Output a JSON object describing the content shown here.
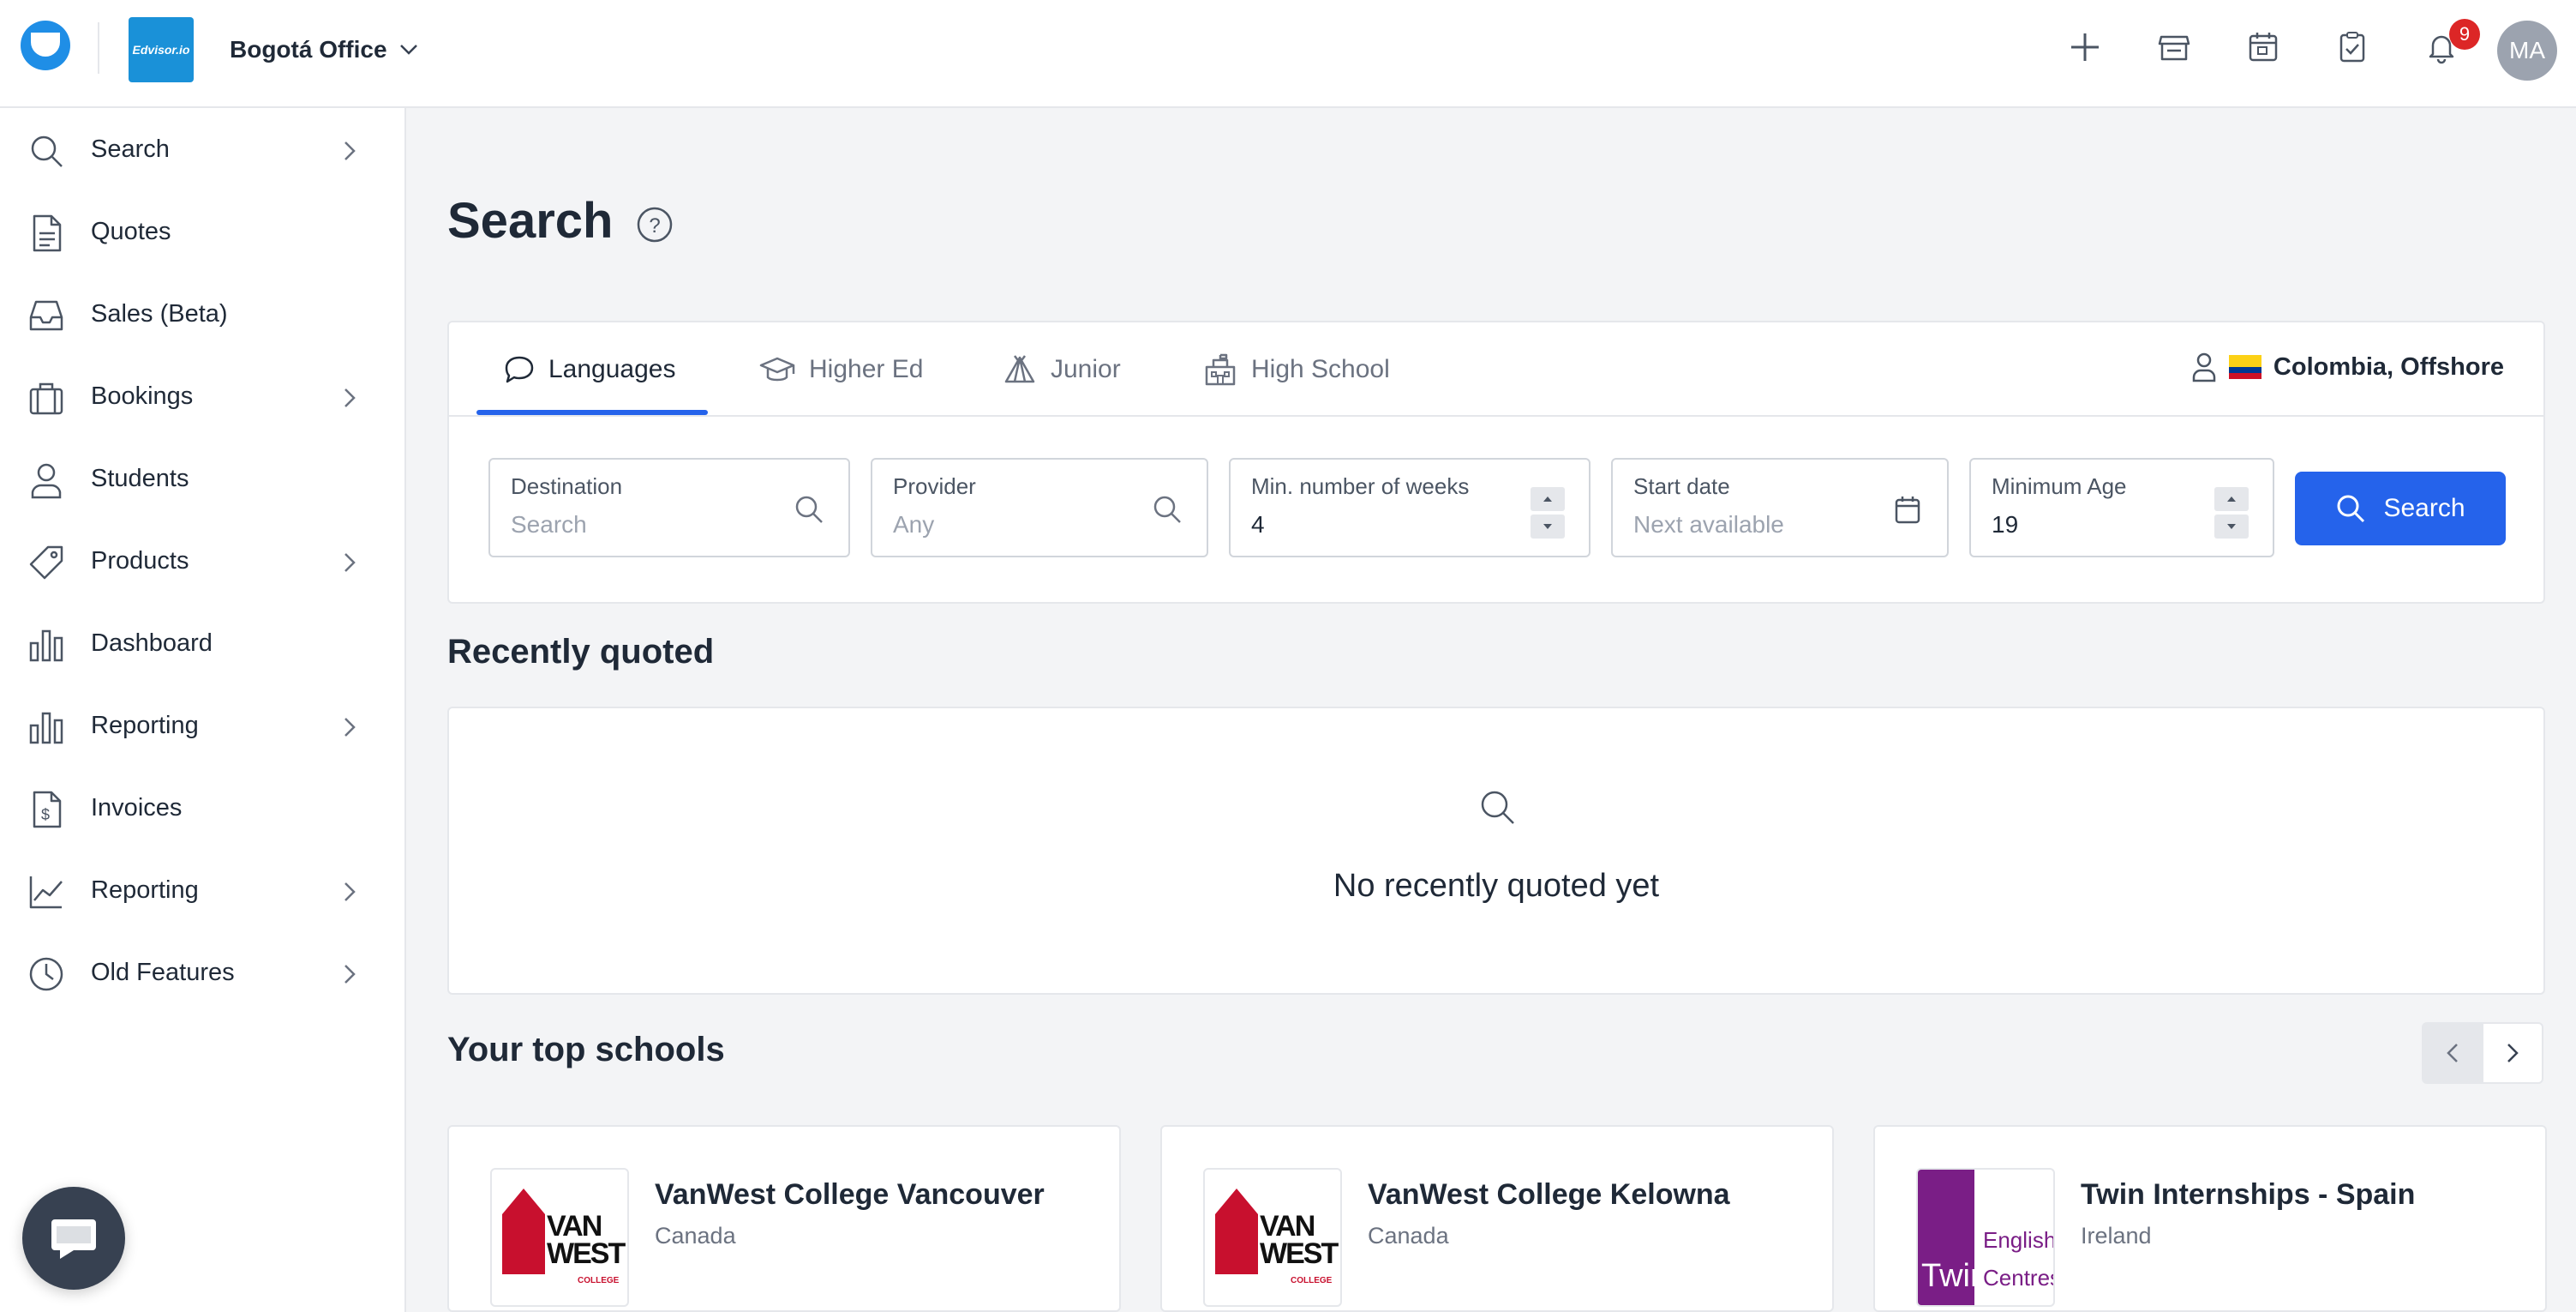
{
  "topbar": {
    "brand_logo_text": "Edvisor.io",
    "office": "Bogotá Office",
    "notification_count": "9",
    "avatar_initials": "MA"
  },
  "sidebar": {
    "items": [
      {
        "label": "Search",
        "icon": "search-icon",
        "has_submenu": true
      },
      {
        "label": "Quotes",
        "icon": "document-icon",
        "has_submenu": false
      },
      {
        "label": "Sales (Beta)",
        "icon": "inbox-icon",
        "has_submenu": false
      },
      {
        "label": "Bookings",
        "icon": "briefcase-icon",
        "has_submenu": true
      },
      {
        "label": "Students",
        "icon": "user-icon",
        "has_submenu": false
      },
      {
        "label": "Products",
        "icon": "tag-icon",
        "has_submenu": true
      },
      {
        "label": "Dashboard",
        "icon": "bar-chart-icon",
        "has_submenu": false
      },
      {
        "label": "Reporting",
        "icon": "bar-chart-icon",
        "has_submenu": true
      },
      {
        "label": "Invoices",
        "icon": "invoice-icon",
        "has_submenu": false
      },
      {
        "label": "Reporting",
        "icon": "line-chart-icon",
        "has_submenu": true
      },
      {
        "label": "Old Features",
        "icon": "clock-icon",
        "has_submenu": true
      }
    ]
  },
  "page": {
    "title": "Search"
  },
  "search_card": {
    "tabs": [
      {
        "label": "Languages",
        "active": true
      },
      {
        "label": "Higher Ed",
        "active": false
      },
      {
        "label": "Junior",
        "active": false
      },
      {
        "label": "High School",
        "active": false
      }
    ],
    "market": "Colombia, Offshore",
    "fields": {
      "destination": {
        "label": "Destination",
        "placeholder": "Search"
      },
      "provider": {
        "label": "Provider",
        "placeholder": "Any"
      },
      "min_weeks": {
        "label": "Min. number of weeks",
        "value": "4"
      },
      "start_date": {
        "label": "Start date",
        "placeholder": "Next available"
      },
      "min_age": {
        "label": "Minimum Age",
        "value": "19"
      }
    },
    "search_button": "Search"
  },
  "recently_quoted": {
    "heading": "Recently quoted",
    "empty_text": "No recently quoted yet"
  },
  "top_schools": {
    "heading": "Your top schools",
    "schools": [
      {
        "name": "VanWest College Vancouver",
        "country": "Canada",
        "logo_text": "VAN WEST",
        "logo_sub": "COLLEGE"
      },
      {
        "name": "VanWest College Kelowna",
        "country": "Canada",
        "logo_text": "VAN WEST",
        "logo_sub": "COLLEGE"
      },
      {
        "name": "Twin Internships - Spain",
        "country": "Ireland",
        "logo_text": "Twin",
        "logo_sub": "English Centres"
      }
    ]
  },
  "colors": {
    "accent": "#2563eb",
    "badge": "#dc2626",
    "brand": "#1a91d8"
  }
}
